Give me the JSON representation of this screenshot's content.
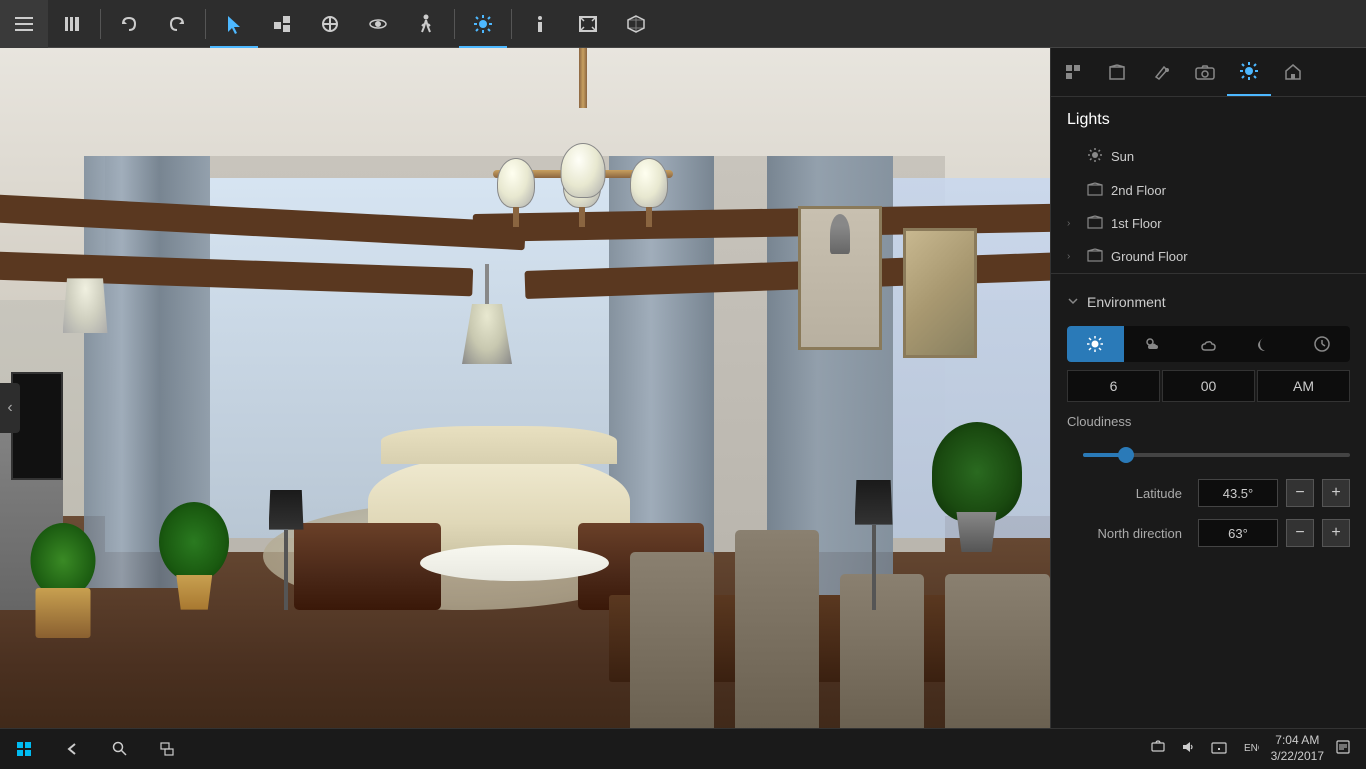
{
  "toolbar": {
    "buttons": [
      {
        "id": "menu",
        "icon": "≡",
        "label": "Menu",
        "active": false
      },
      {
        "id": "library",
        "icon": "📚",
        "label": "Library",
        "active": false
      },
      {
        "id": "undo",
        "icon": "↩",
        "label": "Undo",
        "active": false
      },
      {
        "id": "redo",
        "icon": "↪",
        "label": "Redo",
        "active": false
      },
      {
        "id": "select",
        "icon": "↖",
        "label": "Select",
        "active": true
      },
      {
        "id": "arrange",
        "icon": "⊞",
        "label": "Arrange",
        "active": false
      },
      {
        "id": "draw",
        "icon": "✂",
        "label": "Draw",
        "active": false
      },
      {
        "id": "view3d",
        "icon": "👁",
        "label": "3D View",
        "active": false
      },
      {
        "id": "walk",
        "icon": "🚶",
        "label": "Walk",
        "active": false
      },
      {
        "id": "sun",
        "icon": "☀",
        "label": "Sun/Lights",
        "active": true
      },
      {
        "id": "info",
        "icon": "ℹ",
        "label": "Info",
        "active": false
      },
      {
        "id": "frame",
        "icon": "⬜",
        "label": "Frame",
        "active": false
      },
      {
        "id": "cube",
        "icon": "◻",
        "label": "3D Cube",
        "active": false
      }
    ]
  },
  "right_panel": {
    "icons": [
      {
        "id": "properties",
        "icon": "🛠",
        "label": "Properties"
      },
      {
        "id": "floor",
        "icon": "⬛",
        "label": "Floor"
      },
      {
        "id": "paint",
        "icon": "✏",
        "label": "Paint"
      },
      {
        "id": "camera",
        "icon": "📷",
        "label": "Camera"
      },
      {
        "id": "sun",
        "icon": "☀",
        "label": "Sun",
        "active": true
      },
      {
        "id": "house",
        "icon": "🏠",
        "label": "House"
      }
    ],
    "section_title": "Lights",
    "tree": [
      {
        "label": "Sun",
        "icon": "☀",
        "expandable": false,
        "indent": 0
      },
      {
        "label": "2nd Floor",
        "icon": "🏠",
        "expandable": false,
        "indent": 0
      },
      {
        "label": "1st Floor",
        "icon": "🏠",
        "expandable": true,
        "indent": 0
      },
      {
        "label": "Ground Floor",
        "icon": "🏠",
        "expandable": true,
        "indent": 0
      }
    ],
    "environment": {
      "title": "Environment",
      "weather_buttons": [
        {
          "id": "clear",
          "icon": "☀",
          "label": "Clear",
          "active": true
        },
        {
          "id": "partly",
          "icon": "🌤",
          "label": "Partly Cloudy",
          "active": false
        },
        {
          "id": "cloudy",
          "icon": "☁",
          "label": "Cloudy",
          "active": false
        },
        {
          "id": "night",
          "icon": "☽",
          "label": "Night",
          "active": false
        },
        {
          "id": "clock",
          "icon": "🕐",
          "label": "Custom Time",
          "active": false
        }
      ],
      "time_hour": "6",
      "time_minute": "00",
      "time_ampm": "AM",
      "cloudiness_label": "Cloudiness",
      "cloudiness_value": 15,
      "latitude_label": "Latitude",
      "latitude_value": "43.5°",
      "north_direction_label": "North direction",
      "north_direction_value": "63°"
    }
  },
  "taskbar": {
    "time": "7:04 AM",
    "date": "3/22/2017",
    "start_icon": "⊞",
    "back_icon": "←",
    "cortana_icon": "○",
    "task_view_icon": "⊡"
  },
  "left_panel_toggle": "‹"
}
